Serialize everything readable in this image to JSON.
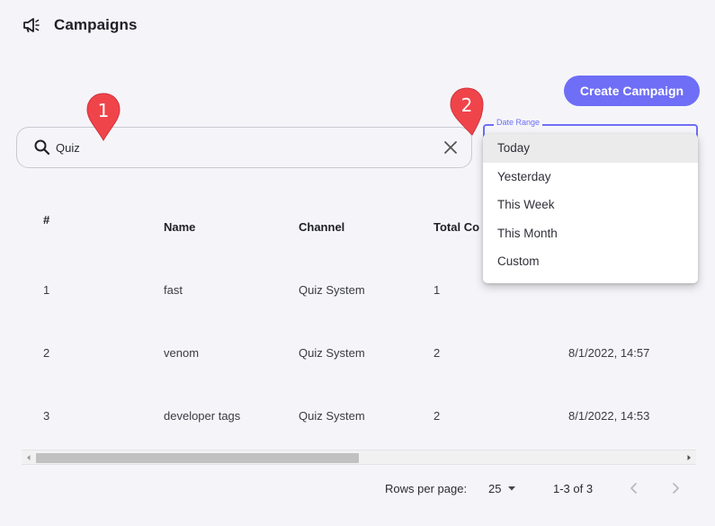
{
  "header": {
    "title": "Campaigns",
    "icon": "megaphone-icon"
  },
  "toolbar": {
    "create_label": "Create Campaign"
  },
  "search": {
    "value": "Quiz",
    "placeholder": ""
  },
  "date_range": {
    "legend": "Date Range",
    "options": [
      "Today",
      "Yesterday",
      "This Week",
      "This Month",
      "Custom"
    ],
    "highlighted": "Today"
  },
  "table": {
    "columns": [
      "#",
      "Name",
      "Channel",
      "Total Co"
    ],
    "rows": [
      {
        "num": "1",
        "name": "fast",
        "channel": "Quiz System",
        "total": "1",
        "date": ""
      },
      {
        "num": "2",
        "name": "venom",
        "channel": "Quiz System",
        "total": "2",
        "date": "8/1/2022, 14:57"
      },
      {
        "num": "3",
        "name": "developer tags",
        "channel": "Quiz System",
        "total": "2",
        "date": "8/1/2022, 14:53"
      }
    ]
  },
  "pagination": {
    "rows_label": "Rows per page:",
    "rows_value": "25",
    "range": "1-3 of 3"
  },
  "markers": {
    "one": "1",
    "two": "2"
  },
  "colors": {
    "accent": "#6e6ef6",
    "marker": "#f0444b"
  }
}
